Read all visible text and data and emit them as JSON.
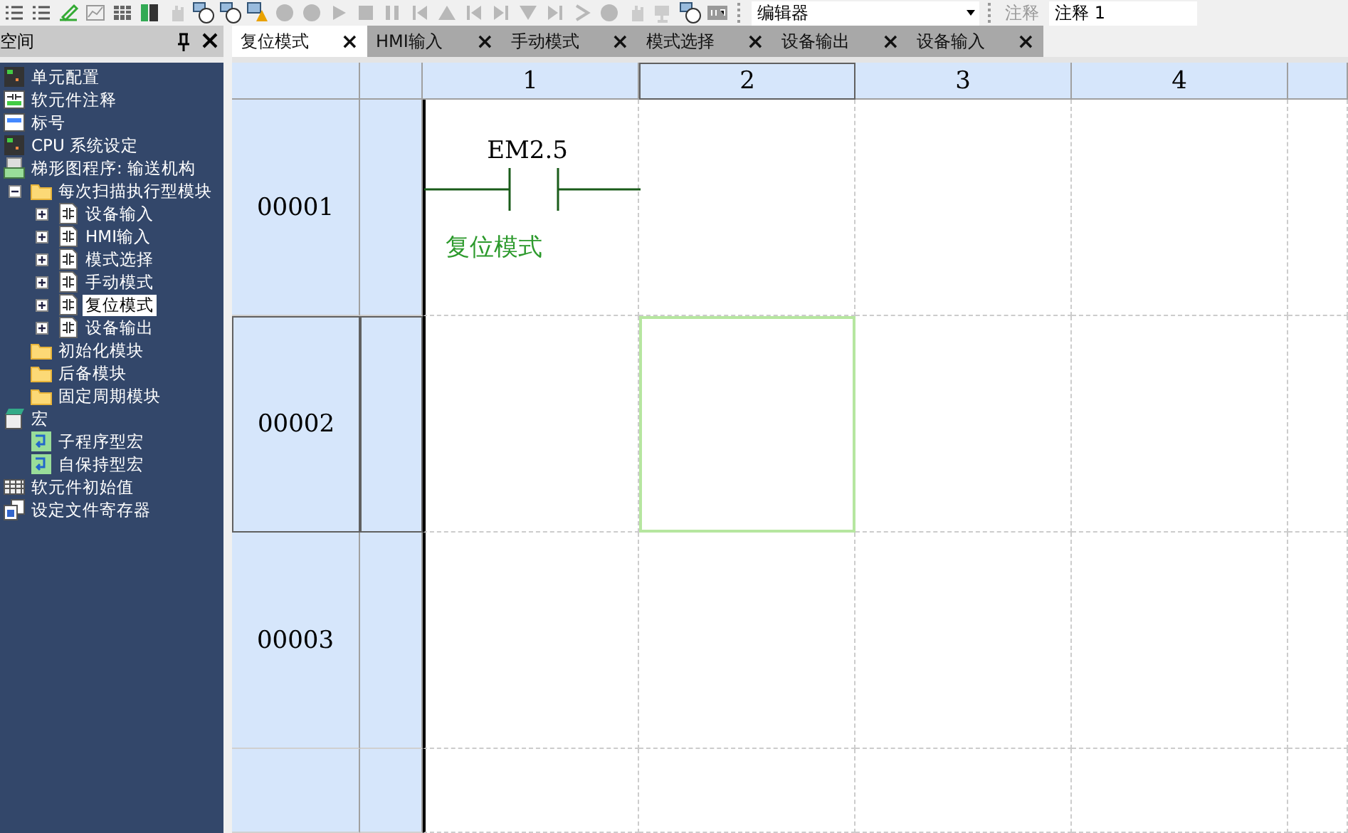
{
  "toolbar": {
    "editor_select": {
      "value": "编辑器"
    },
    "comment_label": "注释",
    "comment_field": {
      "value": "注释 1"
    }
  },
  "workspace": {
    "title": "空间",
    "tree": [
      {
        "label": "单元配置",
        "kind": "module"
      },
      {
        "label": "软元件注释",
        "kind": "comment"
      },
      {
        "label": "标号",
        "kind": "label"
      },
      {
        "label": "CPU 系统设定",
        "kind": "module"
      },
      {
        "label": "梯形图程序: 输送机构",
        "kind": "program",
        "children": [
          {
            "label": "每次扫描执行型模块",
            "kind": "folder",
            "expanded": true,
            "selected": false,
            "children": [
              {
                "label": "设备输入",
                "kind": "ladder",
                "expanded": false,
                "selected": false
              },
              {
                "label": "HMI输入",
                "kind": "ladder",
                "expanded": false,
                "selected": false
              },
              {
                "label": "模式选择",
                "kind": "ladder",
                "expanded": false,
                "selected": false
              },
              {
                "label": "手动模式",
                "kind": "ladder",
                "expanded": false,
                "selected": false
              },
              {
                "label": "复位模式",
                "kind": "ladder",
                "expanded": false,
                "selected": true
              },
              {
                "label": "设备输出",
                "kind": "ladder",
                "expanded": false,
                "selected": false
              }
            ]
          },
          {
            "label": "初始化模块",
            "kind": "folder"
          },
          {
            "label": "后备模块",
            "kind": "folder"
          },
          {
            "label": "固定周期模块",
            "kind": "folder"
          }
        ]
      },
      {
        "label": "宏",
        "kind": "macro",
        "children": [
          {
            "label": "子程序型宏",
            "kind": "submacro"
          },
          {
            "label": "自保持型宏",
            "kind": "submacro"
          }
        ]
      },
      {
        "label": "软元件初始值",
        "kind": "grid"
      },
      {
        "label": "设定文件寄存器",
        "kind": "files"
      }
    ]
  },
  "tabs": [
    {
      "label": "复位模式",
      "selected": true,
      "close": "×"
    },
    {
      "label": "HMI输入",
      "selected": false,
      "close": "×"
    },
    {
      "label": "手动模式",
      "selected": false,
      "close": "×"
    },
    {
      "label": "模式选择",
      "selected": false,
      "close": "×"
    },
    {
      "label": "设备输出",
      "selected": false,
      "close": "×"
    },
    {
      "label": "设备输入",
      "selected": false,
      "close": "×"
    }
  ],
  "ladder": {
    "columns": [
      {
        "label": "1",
        "selected": false
      },
      {
        "label": "2",
        "selected": true
      },
      {
        "label": "3",
        "selected": false
      },
      {
        "label": "4",
        "selected": false
      }
    ],
    "rows": [
      {
        "number": "00001",
        "selected": false,
        "contact": {
          "device": "EM2.5",
          "comment": "复位模式"
        }
      },
      {
        "number": "00002",
        "selected": true
      },
      {
        "number": "00003",
        "selected": false
      }
    ]
  }
}
